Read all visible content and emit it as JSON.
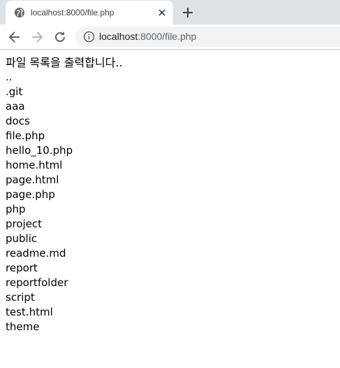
{
  "browser": {
    "tab_title": "localhost:8000/file.php",
    "url_host": "localhost",
    "url_path": ":8000/file.php"
  },
  "colors": {
    "tabstrip_bg": "#dee1e6",
    "omnibox_bg": "#f1f3f4",
    "icon_gray": "#5f6368",
    "icon_disabled": "#b5b8bc"
  },
  "icons": {
    "favicon": "globe-icon",
    "close": "close-icon",
    "new_tab": "plus-icon",
    "back": "arrow-left-icon",
    "forward": "arrow-right-icon",
    "reload": "reload-icon",
    "site_info": "info-icon"
  },
  "page": {
    "heading": "파일 목록을 출력합니다..",
    "files": [
      "..",
      ".git",
      "aaa",
      "docs",
      "file.php",
      "hello_10.php",
      "home.html",
      "page.html",
      "page.php",
      "php",
      "project",
      "public",
      "readme.md",
      "report",
      "reportfolder",
      "script",
      "test.html",
      "theme"
    ]
  }
}
